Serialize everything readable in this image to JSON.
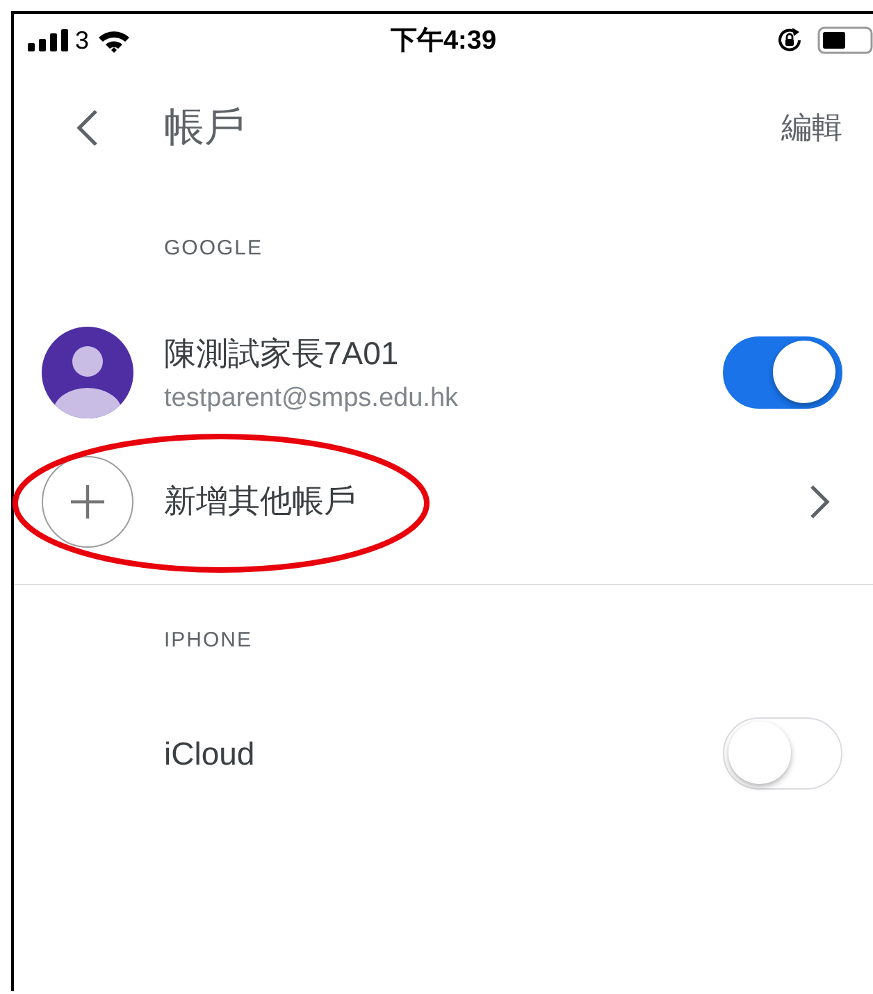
{
  "status_bar": {
    "carrier": "3",
    "time": "下午4:39"
  },
  "nav": {
    "title": "帳戶",
    "edit": "編輯"
  },
  "sections": [
    {
      "header": "GOOGLE",
      "rows": [
        {
          "kind": "account",
          "name": "陳測試家長7A01",
          "email": "testparent@smps.edu.hk",
          "on": true
        },
        {
          "kind": "add",
          "label": "新增其他帳戶"
        }
      ]
    },
    {
      "header": "IPHONE",
      "rows": [
        {
          "kind": "toggle",
          "label": "iCloud",
          "on": false
        }
      ]
    }
  ]
}
